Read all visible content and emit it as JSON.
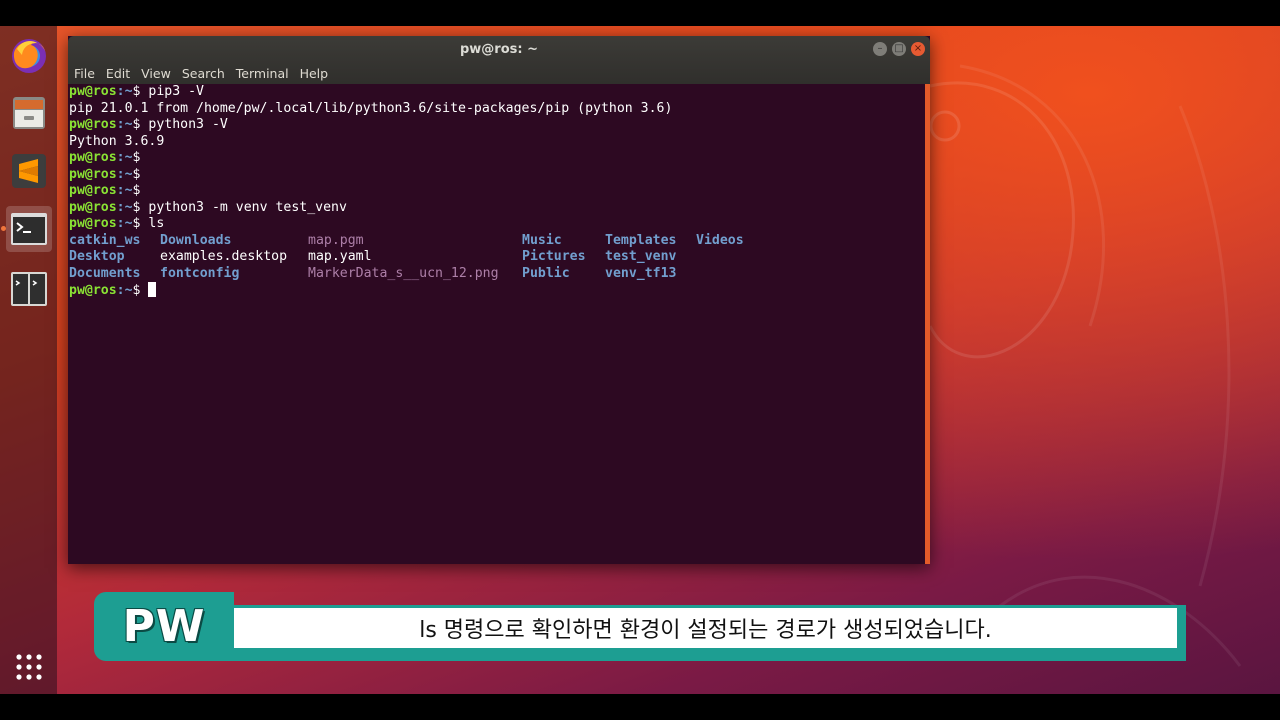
{
  "window": {
    "title": "pw@ros: ~",
    "menu": [
      "File",
      "Edit",
      "View",
      "Search",
      "Terminal",
      "Help"
    ]
  },
  "terminal": {
    "prompt_user": "pw@ros",
    "prompt_path": ":~",
    "prompt_sym": "$",
    "lines": [
      {
        "type": "cmd",
        "text": " pip3 -V"
      },
      {
        "type": "out",
        "text": "pip 21.0.1 from /home/pw/.local/lib/python3.6/site-packages/pip (python 3.6)"
      },
      {
        "type": "cmd",
        "text": " python3 -V"
      },
      {
        "type": "out",
        "text": "Python 3.6.9"
      },
      {
        "type": "cmd",
        "text": ""
      },
      {
        "type": "cmd",
        "text": ""
      },
      {
        "type": "cmd",
        "text": ""
      },
      {
        "type": "cmd",
        "text": " python3 -m venv test_venv"
      },
      {
        "type": "cmd",
        "text": " ls"
      }
    ],
    "ls_rows": [
      [
        {
          "name": "catkin_ws",
          "kind": "dir"
        },
        {
          "name": "Downloads",
          "kind": "dir"
        },
        {
          "name": "map.pgm",
          "kind": "img"
        },
        {
          "name": "Music",
          "kind": "dir"
        },
        {
          "name": "Templates",
          "kind": "dir"
        },
        {
          "name": "Videos",
          "kind": "dir"
        }
      ],
      [
        {
          "name": "Desktop",
          "kind": "dir"
        },
        {
          "name": "examples.desktop",
          "kind": "file"
        },
        {
          "name": "map.yaml",
          "kind": "file"
        },
        {
          "name": "Pictures",
          "kind": "dir"
        },
        {
          "name": "test_venv",
          "kind": "dir"
        },
        {
          "name": "",
          "kind": "file"
        }
      ],
      [
        {
          "name": "Documents",
          "kind": "dir"
        },
        {
          "name": "fontconfig",
          "kind": "dir"
        },
        {
          "name": "MarkerData_s__ucn_12.png",
          "kind": "img"
        },
        {
          "name": "Public",
          "kind": "dir"
        },
        {
          "name": "venv_tf13",
          "kind": "dir"
        },
        {
          "name": "",
          "kind": "file"
        }
      ]
    ]
  },
  "dock": {
    "items": [
      "firefox-icon",
      "files-icon",
      "sublime-text-icon",
      "terminal-icon",
      "system-monitor-icon",
      "show-apps-icon"
    ]
  },
  "subtitle": {
    "tag": "PW",
    "text": "ls 명령으로 확인하면 환경이 설정되는 경로가 생성되었습니다."
  },
  "colors": {
    "prompt": "#8ae234",
    "directory": "#729fcf",
    "terminal_bg": "#2d0922",
    "accent": "#1d9e92"
  }
}
